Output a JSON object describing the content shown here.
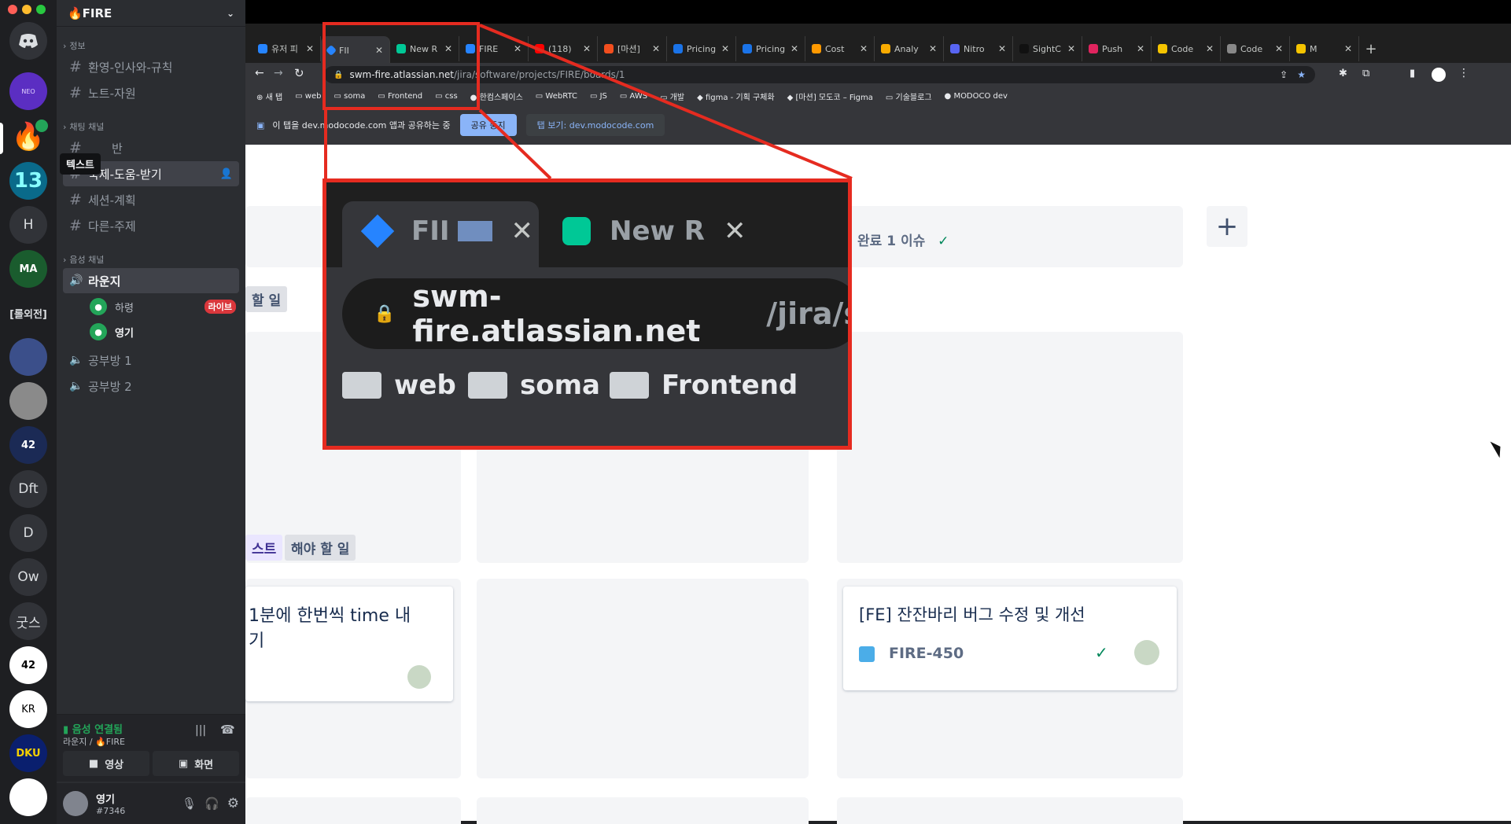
{
  "server": {
    "name": "🔥FIRE"
  },
  "tooltip": "텍스트",
  "channel_categories": {
    "info": "정보",
    "text": "채팅 채널",
    "voice": "음성 채널"
  },
  "info_channels": [
    "환영-인사와-규칙",
    "노트-자원"
  ],
  "text_channels": [
    "반",
    "숙제-도움-받기",
    "세션-계획",
    "다른-주제"
  ],
  "voice_channels": {
    "lounge": "라운지",
    "lounge_users": [
      {
        "name": "하령",
        "badge": "라이브"
      },
      {
        "name": "영기",
        "badge": ""
      }
    ],
    "others": [
      "공부방 1",
      "공부방 2"
    ]
  },
  "voice_status": {
    "title": "음성 연결됨",
    "location": "라운지 / 🔥FIRE",
    "video_label": "영상",
    "screen_label": "화면"
  },
  "user": {
    "name": "영기",
    "tag": "#7346"
  },
  "rail_servers": [
    "H",
    "[롤외전]",
    "Dft",
    "D",
    "Ow",
    "굿스"
  ],
  "browser": {
    "tabs": [
      "유저 피",
      "FII",
      "New R",
      "FIRE",
      "(118)",
      "[마션]",
      "Pricing",
      "Pricing",
      "Cost",
      "Analy",
      "Nitro",
      "SightC",
      "Push",
      "Code",
      "Code",
      "M"
    ],
    "url_host": "swm-fire.atlassian.net",
    "url_path": "/jira/software/projects/FIRE/boards/1",
    "bookmarks": [
      "새 탭",
      "web",
      "soma",
      "Frontend",
      "css",
      "한컴스페이스",
      "WebRTC",
      "JS",
      "AWS",
      "개발",
      "figma - 기획 구체화",
      "[마션] 모도코 – Figma",
      "기술블로그",
      "MODOCO dev"
    ],
    "share_notice": "이 탭을 dev.modocode.com 앱과 공유하는 중",
    "share_stop": "공유 중지",
    "share_view": "탭 보기: dev.modocode.com"
  },
  "board": {
    "done_header": "완료 1 이슈",
    "label_todo1": "할 일",
    "label_test": "스트",
    "label_todo2": "해야 할 일",
    "card_left": "1분에 한번씩 time 내기",
    "card_right_title": "[FE] 잔잔바리 버그 수정 및 개선",
    "card_right_key": "FIRE-450"
  },
  "zoom": {
    "tab1": "FII",
    "tab2": "New R",
    "url_host": "swm-fire.atlassian.net",
    "url_path": "/jira/s",
    "folders": [
      "web",
      "soma",
      "Frontend"
    ]
  }
}
